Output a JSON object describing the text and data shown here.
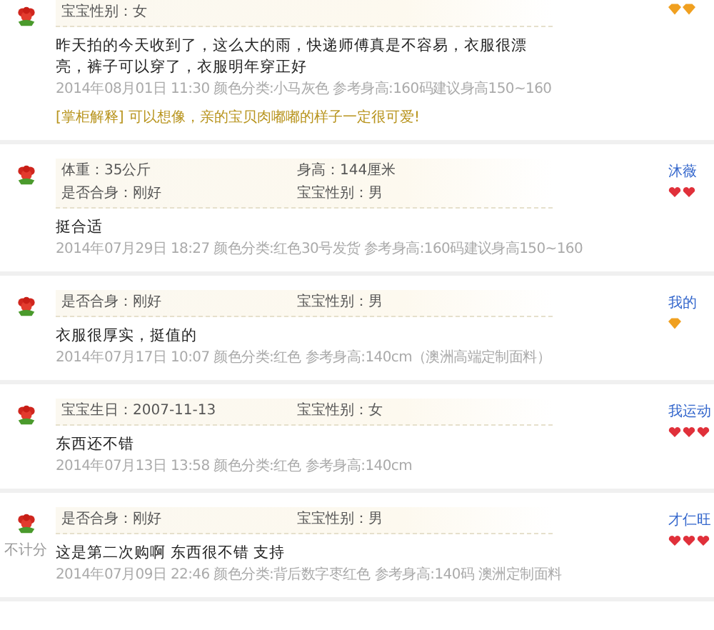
{
  "reviews": [
    {
      "attributes": [
        "宝宝性别：女"
      ],
      "comment": "昨天拍的今天收到了，这么大的雨，快递师傅真是不容易，衣服很漂亮，裤子可以穿了，衣服明年穿正好",
      "meta": "2014年08月01日 11:30 颜色分类:小马灰色  参考身高:160码建议身高150~160",
      "reply": "[掌柜解释] 可以想像，亲的宝贝肉嘟嘟的样子一定很可爱!",
      "badges": [
        {
          "kind": "diamond"
        },
        {
          "kind": "diamond"
        }
      ]
    },
    {
      "attributes": [
        "体重：35公斤",
        "身高：144厘米",
        "是否合身：刚好",
        "宝宝性别：男"
      ],
      "comment": "挺合适",
      "meta": "2014年07月29日 18:27 颜色分类:红色30号发货  参考身高:160码建议身高150~160",
      "user": "沐薇",
      "badges": [
        {
          "kind": "heart"
        },
        {
          "kind": "heart"
        }
      ]
    },
    {
      "attributes": [
        "是否合身：刚好",
        "宝宝性别：男"
      ],
      "comment": "衣服很厚实，挺值的",
      "meta": "2014年07月17日 10:07 颜色分类:红色  参考身高:140cm（澳洲高端定制面料）",
      "user": "我的",
      "badges": [
        {
          "kind": "diamond"
        }
      ]
    },
    {
      "attributes": [
        "宝宝生日：2007-11-13",
        "宝宝性别：女"
      ],
      "comment": "东西还不错",
      "meta": "2014年07月13日 13:58 颜色分类:红色  参考身高:140cm",
      "user": "我运动",
      "badges": [
        {
          "kind": "heart"
        },
        {
          "kind": "heart"
        },
        {
          "kind": "heart"
        }
      ]
    },
    {
      "score_note": "不计分",
      "attributes": [
        "是否合身：刚好",
        "宝宝性别：男"
      ],
      "comment": "这是第二次购啊 东西很不错 支持",
      "meta": "2014年07月09日 22:46 颜色分类:背后数字枣红色  参考身高:140码 澳洲定制面料",
      "user": "才仁旺",
      "badges": [
        {
          "kind": "heart"
        },
        {
          "kind": "heart"
        },
        {
          "kind": "heart"
        }
      ]
    }
  ]
}
